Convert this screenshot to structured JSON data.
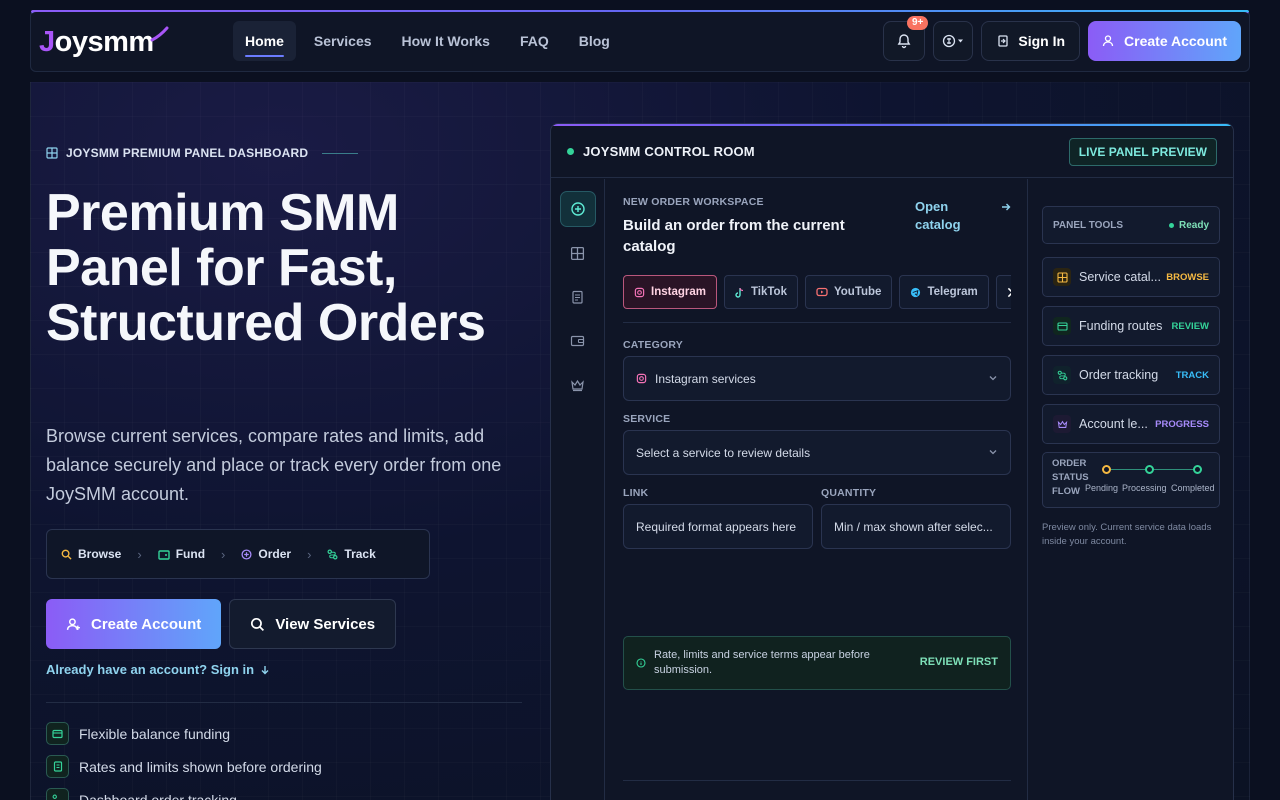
{
  "brand": {
    "logo_j": "J",
    "logo_rest": "oysmm"
  },
  "nav": {
    "links": [
      "Home",
      "Services",
      "How It Works",
      "FAQ",
      "Blog"
    ],
    "notifications_badge": "9+",
    "sign_in": "Sign In",
    "create_account": "Create Account"
  },
  "hero": {
    "eyebrow": "JOYSMM PREMIUM PANEL DASHBOARD",
    "title": "Premium SMM Panel for Fast, Structured Orders",
    "description": "Browse current services, compare rates and limits, add balance securely and place or track every order from one JoySMM account.",
    "steps": [
      "Browse",
      "Fund",
      "Order",
      "Track"
    ],
    "cta_primary": "Create Account",
    "cta_secondary": "View Services",
    "signin_link": "Already have an account? Sign in",
    "features": [
      "Flexible balance funding",
      "Rates and limits shown before ordering",
      "Dashboard order tracking"
    ]
  },
  "panel": {
    "title": "JOYSMM CONTROL ROOM",
    "badge": "LIVE PANEL PREVIEW",
    "workspace": {
      "eyebrow": "NEW ORDER WORKSPACE",
      "title": "Build an order from the current catalog",
      "open_catalog": "Open catalog",
      "platforms": [
        "Instagram",
        "TikTok",
        "YouTube",
        "Telegram",
        "X"
      ],
      "category_label": "CATEGORY",
      "category_value": "Instagram services",
      "service_label": "SERVICE",
      "service_value": "Select a service to review details",
      "link_label": "LINK",
      "link_placeholder": "Required format appears here",
      "quantity_label": "QUANTITY",
      "quantity_placeholder": "Min / max shown after selec...",
      "info_text": "Rate, limits and service terms appear before submission.",
      "info_action": "REVIEW FIRST"
    },
    "tools": {
      "header": "PANEL TOOLS",
      "status": "Ready",
      "items": [
        {
          "label": "Service catal...",
          "tag": "BROWSE",
          "color": "#f5b942"
        },
        {
          "label": "Funding routes",
          "tag": "REVIEW",
          "color": "#34d399"
        },
        {
          "label": "Order tracking",
          "tag": "TRACK",
          "color": "#38bdf8"
        },
        {
          "label": "Account le...",
          "tag": "PROGRESS",
          "color": "#a78bfa"
        }
      ],
      "flow_label": "ORDER STATUS FLOW",
      "flow_steps": [
        "Pending",
        "Processing",
        "Completed"
      ],
      "note": "Preview only. Current service data loads inside your account."
    }
  },
  "colors": {
    "accent_purple": "#8b5cf6",
    "accent_blue": "#60a5fa",
    "accent_teal": "#34d399",
    "bg": "#0b1020"
  }
}
